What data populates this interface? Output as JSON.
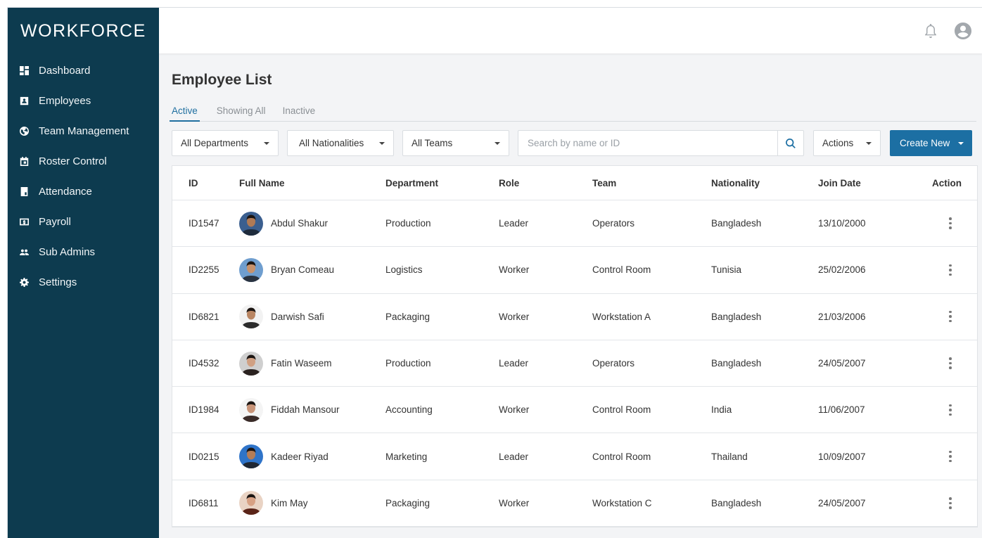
{
  "app": {
    "brand": "WORKFORCE"
  },
  "sidebar": {
    "items": [
      {
        "label": "Dashboard",
        "icon": "dashboard-icon"
      },
      {
        "label": "Employees",
        "icon": "id-card-icon"
      },
      {
        "label": "Team Management",
        "icon": "globe-icon"
      },
      {
        "label": "Roster Control",
        "icon": "calendar-icon"
      },
      {
        "label": "Attendance",
        "icon": "book-icon"
      },
      {
        "label": "Payroll",
        "icon": "money-icon"
      },
      {
        "label": "Sub Admins",
        "icon": "users-icon"
      },
      {
        "label": "Settings",
        "icon": "gear-icon"
      }
    ]
  },
  "topbar": {
    "icons": [
      "bell-icon",
      "user-circle-icon"
    ]
  },
  "page": {
    "title": "Employee List",
    "tabs": [
      {
        "label": "Active",
        "active": true
      },
      {
        "label": "Showing All",
        "active": false
      },
      {
        "label": "Inactive",
        "active": false
      }
    ]
  },
  "filters": {
    "department": "All Departments",
    "nationality": "All Nationalities",
    "team": "All Teams",
    "search_placeholder": "Search by name or ID",
    "actions": "Actions",
    "create_new": "Create New"
  },
  "table": {
    "columns": [
      "ID",
      "Full Name",
      "Department",
      "Role",
      "Team",
      "Nationality",
      "Join Date",
      "Action"
    ],
    "rows": [
      {
        "id": "ID1547",
        "name": "Abdul Shakur",
        "department": "Production",
        "role": "Leader",
        "team": "Operators",
        "nationality": "Bangladesh",
        "join_date": "13/10/2000",
        "avatar_bg": "#3b5f8f",
        "avatar_fg": "#1e2b3c",
        "avatar_skin": "#b07a55"
      },
      {
        "id": "ID2255",
        "name": "Bryan Comeau",
        "department": "Logistics",
        "role": "Worker",
        "team": "Control Room",
        "nationality": "Tunisia",
        "join_date": "25/02/2006",
        "avatar_bg": "#6f9ecf",
        "avatar_fg": "#2a3340",
        "avatar_skin": "#c7926c"
      },
      {
        "id": "ID6821",
        "name": "Darwish Safi",
        "department": "Packaging",
        "role": "Worker",
        "team": "Workstation A",
        "nationality": "Bangladesh",
        "join_date": "21/03/2006",
        "avatar_bg": "#f2f2f2",
        "avatar_fg": "#2b2b2b",
        "avatar_skin": "#b98562"
      },
      {
        "id": "ID4532",
        "name": "Fatin Waseem",
        "department": "Production",
        "role": "Leader",
        "team": "Operators",
        "nationality": "Bangladesh",
        "join_date": "24/05/2007",
        "avatar_bg": "#cfcfcf",
        "avatar_fg": "#2a2220",
        "avatar_skin": "#d0a083"
      },
      {
        "id": "ID1984",
        "name": "Fiddah Mansour",
        "department": "Accounting",
        "role": "Worker",
        "team": "Control Room",
        "nationality": "India",
        "join_date": "11/06/2007",
        "avatar_bg": "#f4f4f4",
        "avatar_fg": "#3a2b28",
        "avatar_skin": "#c89478"
      },
      {
        "id": "ID0215",
        "name": "Kadeer Riyad",
        "department": "Marketing",
        "role": "Leader",
        "team": "Control Room",
        "nationality": "Thailand",
        "join_date": "10/09/2007",
        "avatar_bg": "#2f74c9",
        "avatar_fg": "#1f2733",
        "avatar_skin": "#b57d57"
      },
      {
        "id": "ID6811",
        "name": "Kim May",
        "department": "Packaging",
        "role": "Worker",
        "team": "Workstation C",
        "nationality": "Bangladesh",
        "join_date": "24/05/2007",
        "avatar_bg": "#e9d3c4",
        "avatar_fg": "#5a2418",
        "avatar_skin": "#d7a184"
      }
    ]
  },
  "colors": {
    "sidebar": "#0d3b4f",
    "accent": "#1c6fa3",
    "active_tab": "#1f6fa0",
    "background": "#f3f4f6"
  }
}
